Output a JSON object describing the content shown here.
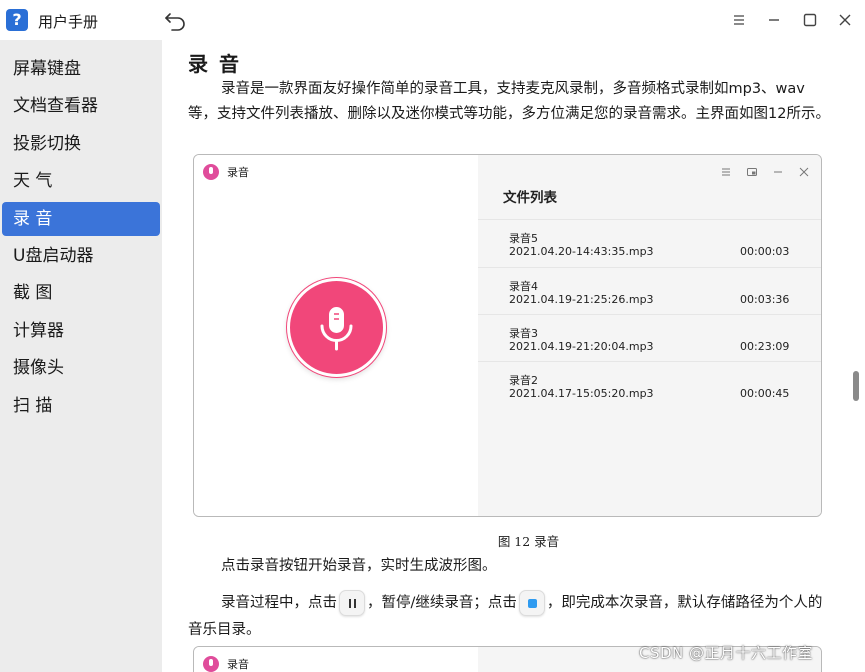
{
  "app": {
    "title": "用户手册",
    "icon": "question-mark-help-icon"
  },
  "window_controls": [
    "menu-icon",
    "minimize-icon",
    "maximize-icon",
    "close-icon"
  ],
  "sidebar": {
    "items": [
      {
        "label": "屏幕键盘",
        "active": false
      },
      {
        "label": "文档查看器",
        "active": false
      },
      {
        "label": "投影切换",
        "active": false
      },
      {
        "label": "天 气",
        "active": false
      },
      {
        "label": "录 音",
        "active": true
      },
      {
        "label": "U盘启动器",
        "active": false
      },
      {
        "label": "截 图",
        "active": false
      },
      {
        "label": "计算器",
        "active": false
      },
      {
        "label": "摄像头",
        "active": false
      },
      {
        "label": "扫 描",
        "active": false
      }
    ],
    "active_color": "#3b74d9"
  },
  "content": {
    "title": "录 音",
    "paragraph1": "录音是一款界面友好操作简单的录音工具，支持麦克风录制，多音频格式录制如mp3、wav等，支持文件列表播放、删除以及迷你模式等功能，多方位满足您的录音需求。主界面如图12所示。",
    "figure": {
      "app_title": "录音",
      "file_list_title": "文件列表",
      "files": [
        {
          "name": "录音5",
          "file": "2021.04.20-14:43:35.mp3",
          "duration": "00:00:03"
        },
        {
          "name": "录音4",
          "file": "2021.04.19-21:25:26.mp3",
          "duration": "00:03:36"
        },
        {
          "name": "录音3",
          "file": "2021.04.19-21:20:04.mp3",
          "duration": "00:23:09"
        },
        {
          "name": "录音2",
          "file": "2021.04.17-15:05:20.mp3",
          "duration": "00:00:45"
        }
      ],
      "record_button_color": "#f1477a",
      "caption": "图 12 录音"
    },
    "paragraph2": "点击录音按钮开始录音，实时生成波形图。",
    "paragraph3_part1": "录音过程中，点击",
    "paragraph3_part2": "，暂停/继续录音；点击",
    "paragraph3_part3": "，即完成本次录音，默认存储路径为个人的音乐目录。",
    "next_figure_app_title": "录音"
  },
  "watermark": "CSDN @正月十六工作室"
}
